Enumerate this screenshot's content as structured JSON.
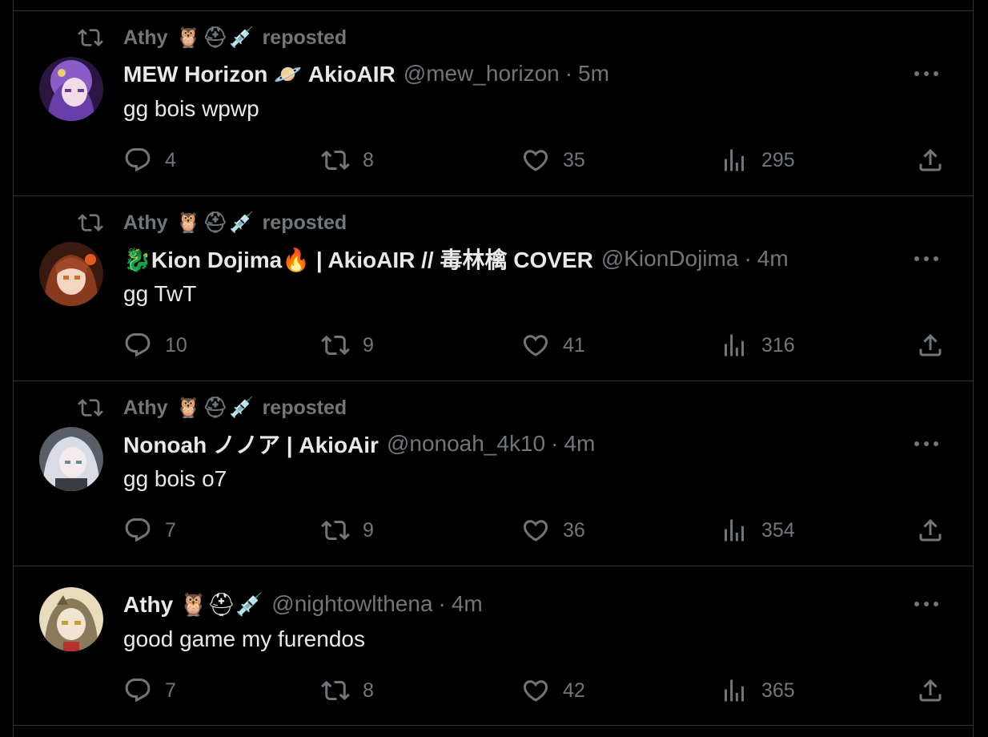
{
  "tweets": [
    {
      "reposter": {
        "name": "Athy",
        "emojis": "🦉⛑💉",
        "label": "reposted"
      },
      "display_name": "MEW Horizon",
      "name_emoji_a": "",
      "name_emoji_b": "🪐",
      "name_suffix": "AkioAIR",
      "handle": "@mew_horizon",
      "dot": "·",
      "time": "5m",
      "text": "gg bois wpwp",
      "stats": {
        "replies": "4",
        "reposts": "8",
        "likes": "35",
        "views": "295"
      },
      "avatar_color": "#7b4bb8"
    },
    {
      "reposter": {
        "name": "Athy",
        "emojis": "🦉⛑💉",
        "label": "reposted"
      },
      "display_name": "Kion Dojima",
      "name_emoji_a": "🐉",
      "name_emoji_b": "🔥",
      "name_suffix": "| AkioAIR // 毒林檎 COVER",
      "handle": "@KionDojima",
      "dot": "·",
      "time": "4m",
      "text": "gg TwT",
      "stats": {
        "replies": "10",
        "reposts": "9",
        "likes": "41",
        "views": "316"
      },
      "avatar_color": "#8a4a2a"
    },
    {
      "reposter": {
        "name": "Athy",
        "emojis": "🦉⛑💉",
        "label": "reposted"
      },
      "display_name": "Nonoah ノノア | AkioAir",
      "name_emoji_a": "",
      "name_emoji_b": "",
      "name_suffix": "",
      "handle": "@nonoah_4k10",
      "dot": "·",
      "time": "4m",
      "text": "gg bois o7",
      "stats": {
        "replies": "7",
        "reposts": "9",
        "likes": "36",
        "views": "354"
      },
      "avatar_color": "#c8ccd4"
    },
    {
      "reposter": null,
      "display_name": "Athy",
      "name_emoji_a": "",
      "name_emoji_b": "🦉⛑💉",
      "name_suffix": "",
      "handle": "@nightowlthena",
      "dot": "·",
      "time": "4m",
      "text": "good game my furendos",
      "stats": {
        "replies": "7",
        "reposts": "8",
        "likes": "42",
        "views": "365"
      },
      "avatar_color": "#d9c9a0"
    }
  ],
  "icons": {
    "repost_indicator": "repost-icon",
    "reply": "reply-icon",
    "repost": "repost-icon",
    "like": "heart-icon",
    "views": "views-icon",
    "share": "share-icon",
    "more": "more-icon"
  },
  "colors": {
    "background": "#000000",
    "text": "#e7e9ea",
    "muted": "#71767b",
    "border": "#2f3336"
  }
}
